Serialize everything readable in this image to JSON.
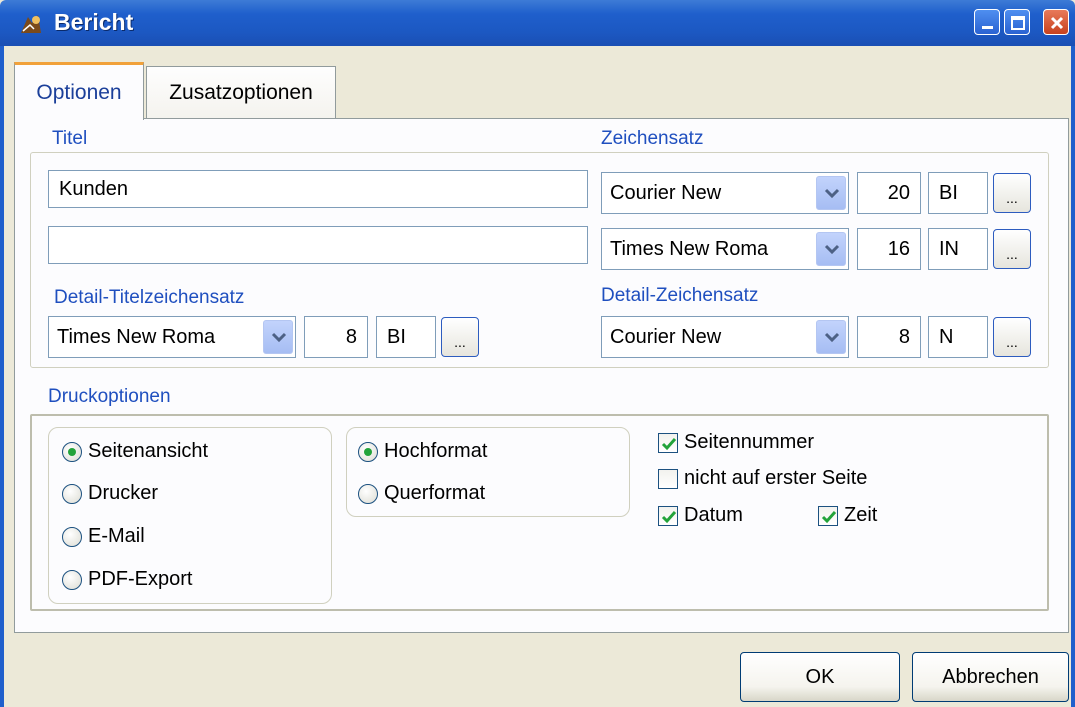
{
  "window": {
    "title": "Bericht"
  },
  "tabs": [
    {
      "label": "Optionen",
      "active": true
    },
    {
      "label": "Zusatzoptionen",
      "active": false
    }
  ],
  "titel": {
    "label": "Titel",
    "line1_value": "Kunden",
    "line2_value": ""
  },
  "zeichensatz": {
    "label": "Zeichensatz",
    "rows": [
      {
        "font": "Courier New",
        "size": "20",
        "style": "BI",
        "button": "..."
      },
      {
        "font": "Times New Roma",
        "size": "16",
        "style": "IN",
        "button": "..."
      }
    ]
  },
  "detail_titel": {
    "label": "Detail-Titelzeichensatz",
    "font": "Times New Roma",
    "size": "8",
    "style": "BI",
    "button": "..."
  },
  "detail_zeichensatz": {
    "label": "Detail-Zeichensatz",
    "font": "Courier New",
    "size": "8",
    "style": "N",
    "button": "..."
  },
  "druckoptionen": {
    "label": "Druckoptionen",
    "ausgabe": [
      {
        "label": "Seitenansicht",
        "selected": true
      },
      {
        "label": "Drucker",
        "selected": false
      },
      {
        "label": "E-Mail",
        "selected": false
      },
      {
        "label": "PDF-Export",
        "selected": false
      }
    ],
    "format": [
      {
        "label": "Hochformat",
        "selected": true
      },
      {
        "label": "Querformat",
        "selected": false
      }
    ],
    "checks": {
      "seitennummer": {
        "label": "Seitennummer",
        "checked": true
      },
      "nicht_erste": {
        "label": "nicht auf erster Seite",
        "checked": false
      },
      "datum": {
        "label": "Datum",
        "checked": true
      },
      "zeit": {
        "label": "Zeit",
        "checked": true
      }
    }
  },
  "buttons": {
    "ok": "OK",
    "cancel": "Abbrechen"
  },
  "colors": {
    "titlebar": "#1f5fcc",
    "label_blue": "#1f4fbf",
    "check_green": "#22a33a"
  }
}
